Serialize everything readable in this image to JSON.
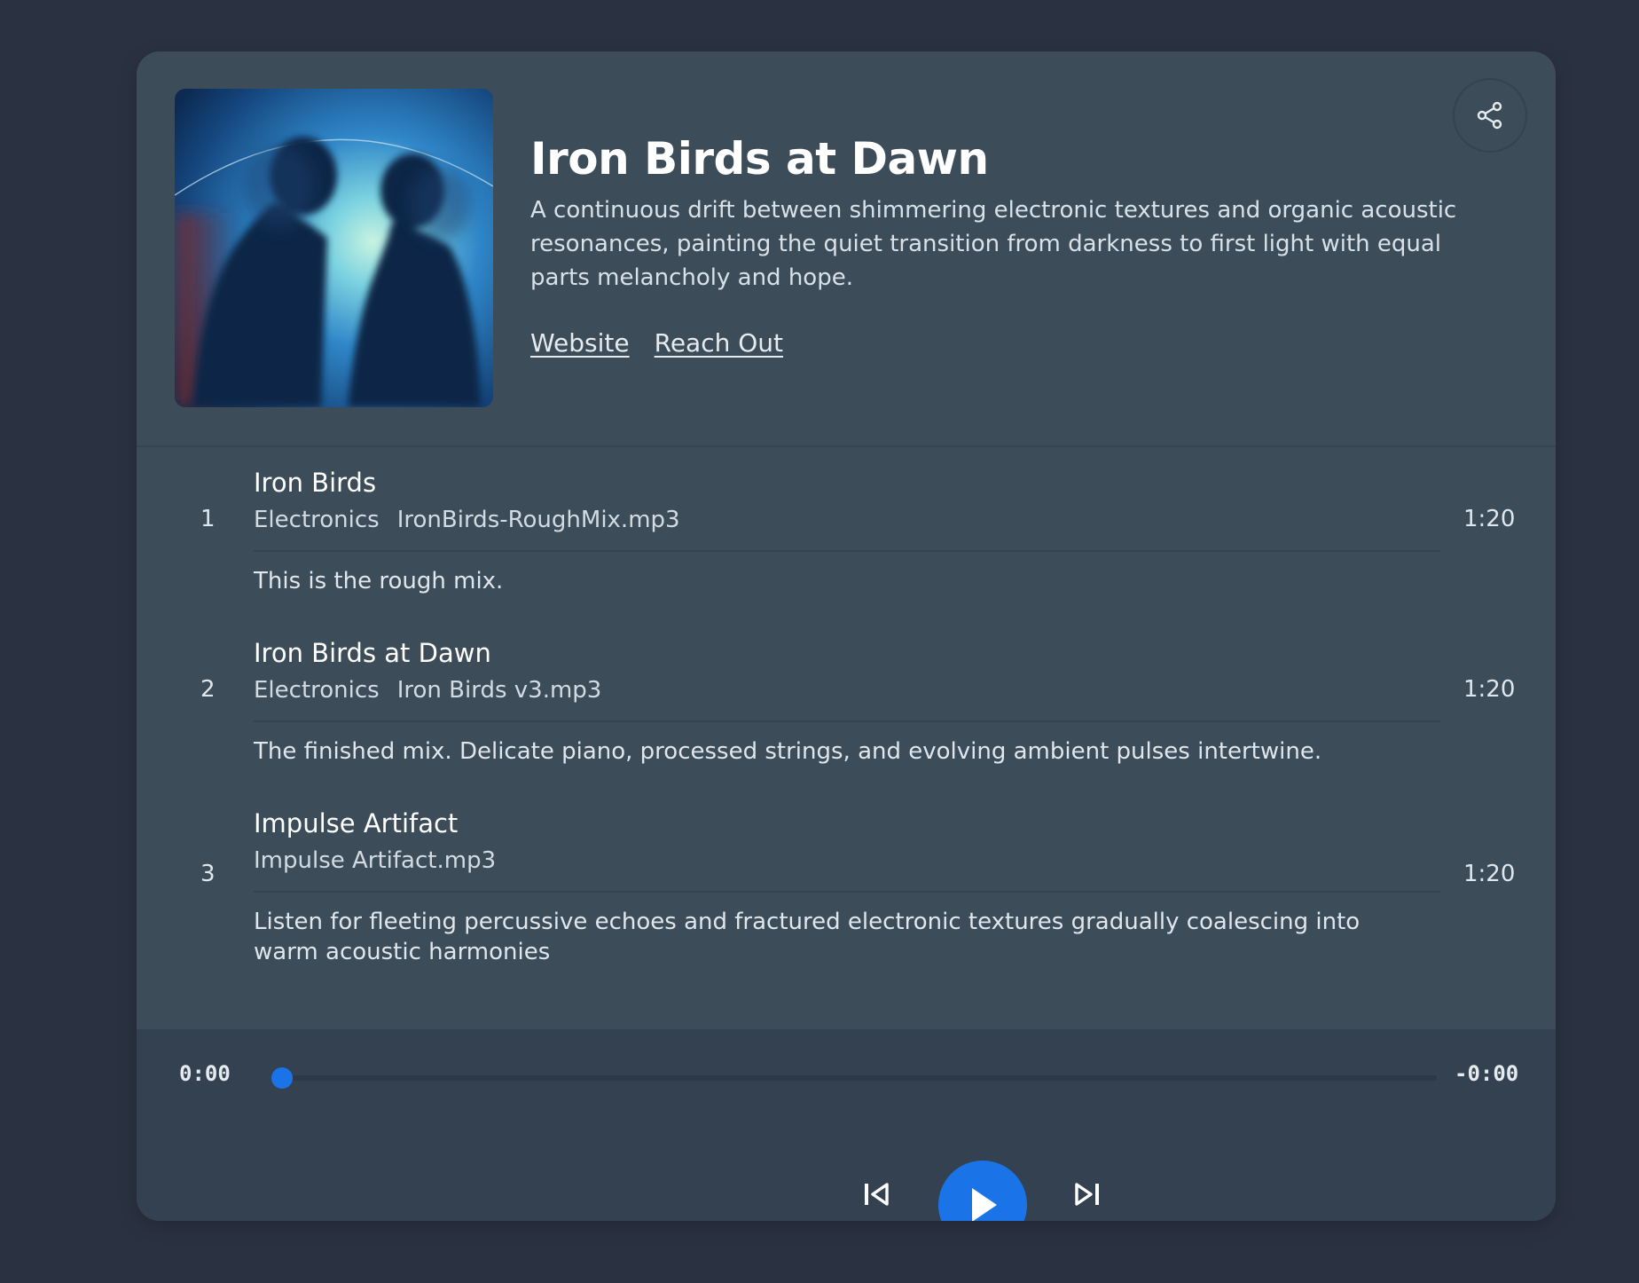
{
  "album": {
    "title": "Iron Birds at Dawn",
    "description": "A continuous drift between shimmering electronic textures and organic acoustic resonances, painting the quiet transition from darkness to first light with equal parts melancholy and hope.",
    "links": [
      "Website",
      "Reach Out"
    ],
    "share_icon": "share-icon",
    "cover_alt": "Album cover: two silhouetted figures against a glowing blue background"
  },
  "tracks": [
    {
      "number": "1",
      "title": "Iron Birds",
      "genre": "Electronics",
      "file": "IronBirds-RoughMix.mp3",
      "note": "This is the rough mix.",
      "duration": "1:20"
    },
    {
      "number": "2",
      "title": "Iron Birds at Dawn",
      "genre": "Electronics",
      "file": "Iron Birds v3.mp3",
      "note": "The finished mix. Delicate piano, processed strings, and evolving ambient pulses intertwine.",
      "duration": "1:20"
    },
    {
      "number": "3",
      "title": "Impulse Artifact",
      "genre": "",
      "file": "Impulse Artifact.mp3",
      "note": "Listen for fleeting percussive echoes and fractured electronic textures gradually coalescing into warm acoustic harmonies",
      "duration": "1:20"
    }
  ],
  "player": {
    "elapsed": "0:00",
    "remaining": "-0:00",
    "progress": 0,
    "accent_color": "#1a74e8",
    "prev_icon": "skip-previous-icon",
    "play_icon": "play-icon",
    "next_icon": "skip-next-icon"
  }
}
